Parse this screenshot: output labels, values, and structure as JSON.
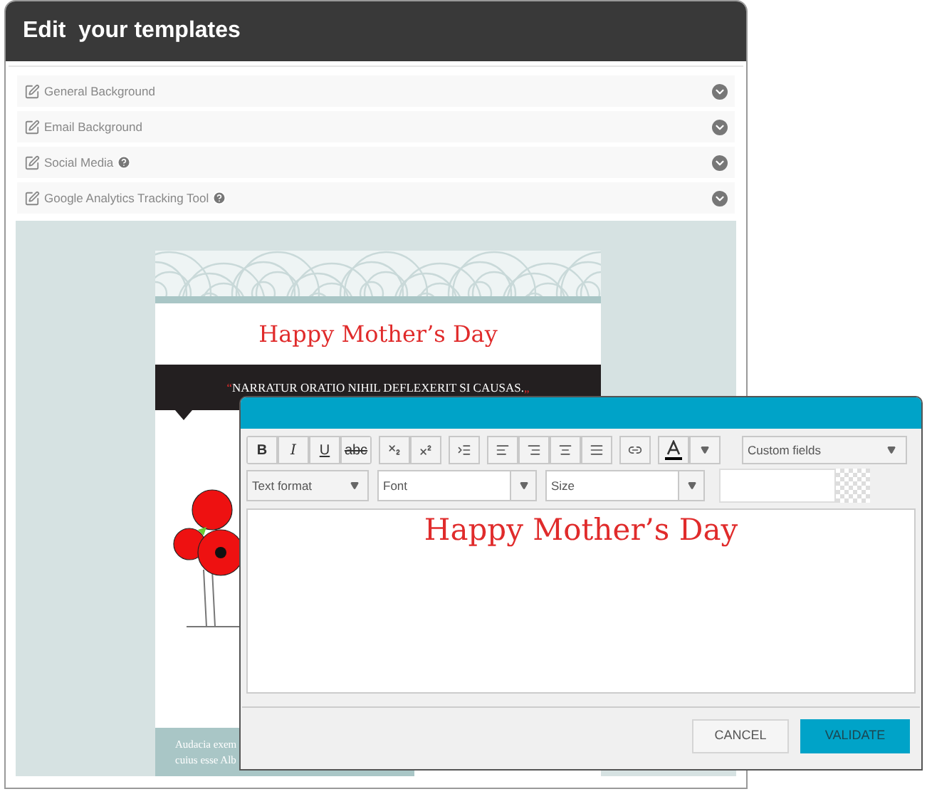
{
  "header": {
    "title": "Edit  your templates"
  },
  "sections": [
    {
      "label": "General Background",
      "help": false,
      "expanded": false
    },
    {
      "label": "Email Background",
      "help": false,
      "expanded": false
    },
    {
      "label": "Social Media",
      "help": true,
      "expanded": false
    },
    {
      "label": "Google Analytics Tracking Tool",
      "help": true,
      "expanded": false
    }
  ],
  "email": {
    "title": "Happy Mother’s Day",
    "open_mark": "“",
    "quote": "NARRATUR ORATIO NIHIL DEFLEXERIT SI CAUSAS.",
    "close_mark": "„",
    "body_lines": [
      "Audacia exem",
      "cuius esse Alb"
    ]
  },
  "editor": {
    "format_buttons": [
      "B",
      "I",
      "U",
      "abc"
    ],
    "custom_fields": "Custom fields",
    "selects": [
      {
        "kind": "select",
        "label": "Text format"
      },
      {
        "kind": "combo",
        "label": "Font"
      },
      {
        "kind": "combo",
        "label": "Size"
      }
    ],
    "content": "Happy Mother’s Day",
    "buttons": [
      {
        "label": "CANCEL",
        "kind": "secondary"
      },
      {
        "label": "VALIDATE",
        "kind": "primary"
      }
    ]
  }
}
